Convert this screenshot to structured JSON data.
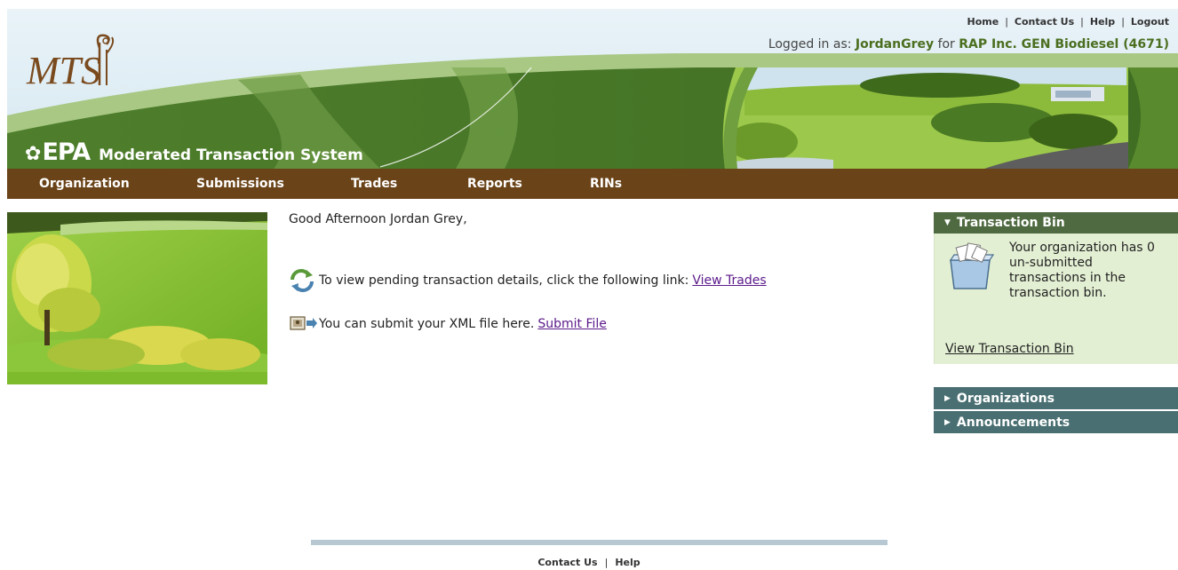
{
  "header": {
    "logo_text": "MTS",
    "epa_mark": "EPA",
    "system_name": "Moderated Transaction System",
    "top_links": [
      "Home",
      "Contact Us",
      "Help",
      "Logout"
    ],
    "logged_in_prefix": "Logged in as:",
    "username": "JordanGrey",
    "for_label": "for",
    "organization": "RAP Inc. GEN Biodiesel (4671)"
  },
  "nav": {
    "items": [
      "Organization",
      "Submissions",
      "Trades",
      "Reports",
      "RINs"
    ]
  },
  "main": {
    "greeting": "Good Afternoon Jordan Grey,",
    "pending_text": "To view pending transaction details, click the following link:",
    "pending_link": "View Trades",
    "submit_text": "You can submit your XML file here.",
    "submit_link": "Submit File"
  },
  "sidebar": {
    "transaction_bin_title": "Transaction Bin",
    "bin_message": "Your organization has 0 un-submitted transactions in the transaction bin.",
    "bin_link": "View Transaction Bin",
    "organizations_title": "Organizations",
    "announcements_title": "Announcements"
  },
  "footer": {
    "links": [
      "Contact Us",
      "Help"
    ]
  },
  "colors": {
    "nav_bg": "#6a4318",
    "banner_green": "#4b7a2a",
    "panel_green": "#4f6a40",
    "panel_teal": "#4a6f72",
    "link_purple": "#5b1a8a"
  }
}
